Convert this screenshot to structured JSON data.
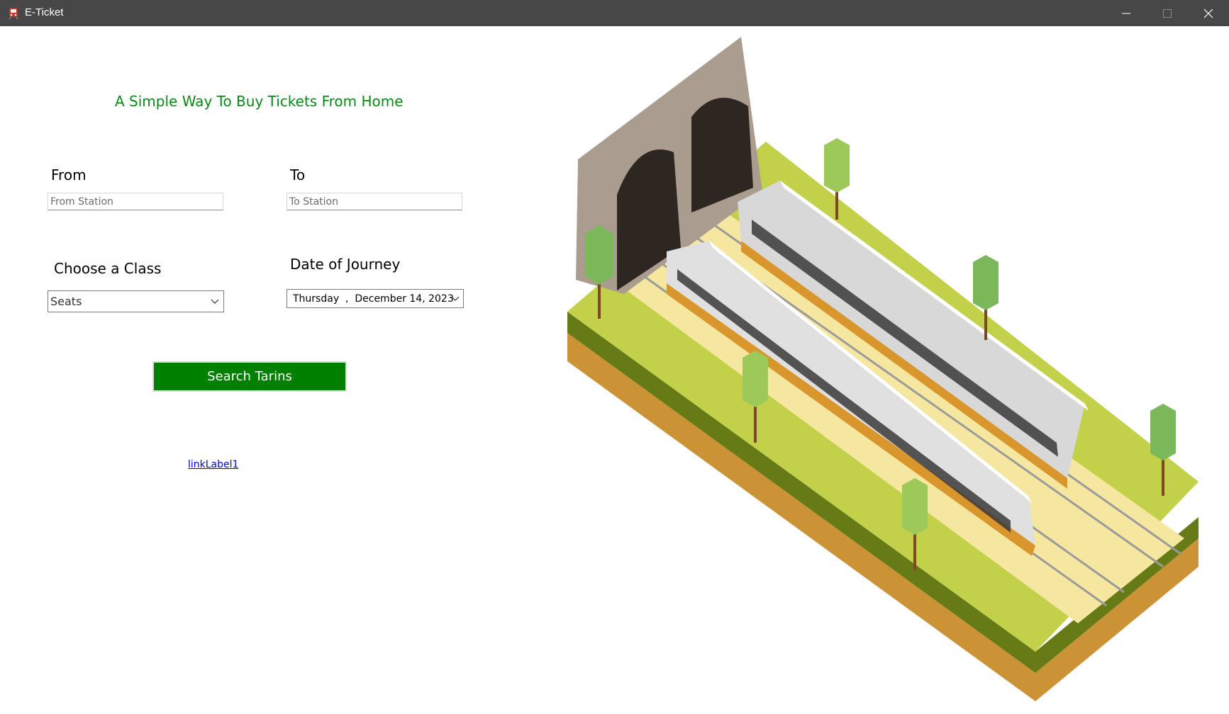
{
  "window": {
    "title": "E-Ticket",
    "controls": {
      "minimize": "—",
      "maximize": "☐",
      "close": "✕"
    }
  },
  "form": {
    "headline": "A Simple Way To Buy Tickets From Home",
    "from_label": "From",
    "from_placeholder": "From Station",
    "to_label": "To",
    "to_placeholder": "To Station",
    "class_label": "Choose a Class",
    "class_value": "Seats",
    "date_label": "Date of Journey",
    "date_value": "Thursday  ,  December 14, 2023",
    "search_button": "Search Tarins",
    "link_label": "linkLabel1"
  },
  "colors": {
    "titlebar": "#474747",
    "headline": "#098a16",
    "button": "#008000",
    "link": "#0000ee",
    "grass": "#c2d04a",
    "track": "#f6e7a0",
    "soil": "#cc9236",
    "tunnel": "#aa9c8e"
  },
  "icons": {
    "app": "train-icon",
    "combo": "chevron-down-icon",
    "date": "chevron-down-icon"
  }
}
